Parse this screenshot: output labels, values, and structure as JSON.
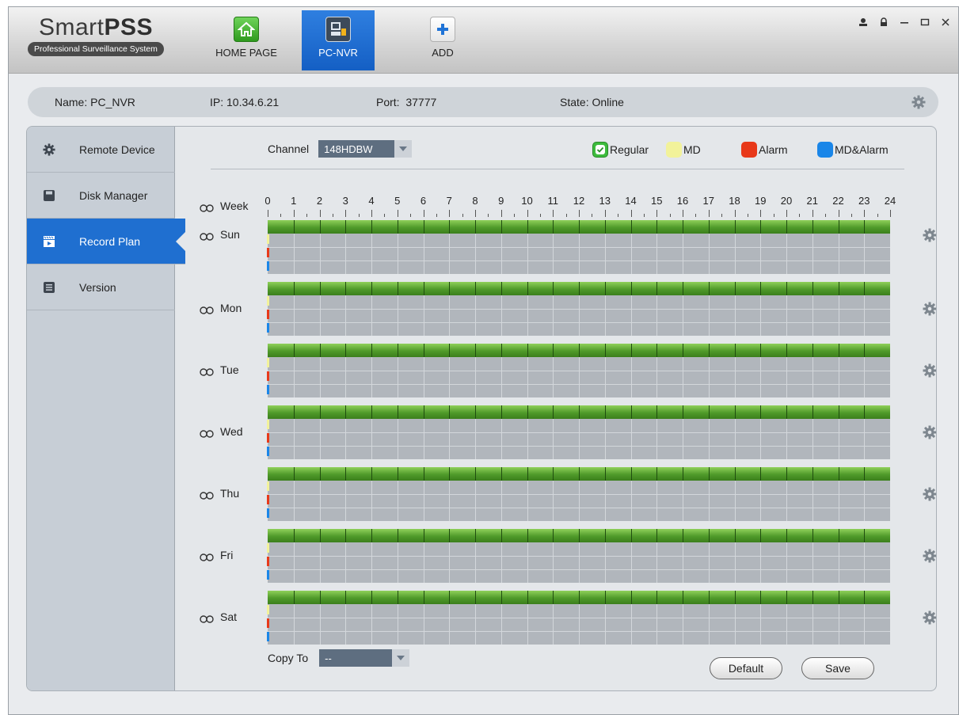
{
  "app": {
    "logo_light": "Smart",
    "logo_bold": "PSS",
    "logo_sub": "Professional Surveillance System"
  },
  "nav": [
    {
      "label": "HOME PAGE",
      "icon": "home-icon"
    },
    {
      "label": "PC-NVR",
      "icon": "nvr-icon"
    },
    {
      "label": "ADD",
      "icon": "plus-icon"
    }
  ],
  "device": {
    "name_label": "Name:",
    "name": "PC_NVR",
    "ip_label": "IP:",
    "ip": "10.34.6.21",
    "port_label": "Port:",
    "port": "37777",
    "state_label": "State:",
    "state": "Online"
  },
  "sidebar": [
    {
      "label": "Remote Device",
      "icon": "gear-icon"
    },
    {
      "label": "Disk Manager",
      "icon": "disk-icon"
    },
    {
      "label": "Record Plan",
      "icon": "record-plan-icon"
    },
    {
      "label": "Version",
      "icon": "version-icon"
    }
  ],
  "channel": {
    "label": "Channel",
    "value": "148HDBW"
  },
  "legend": [
    {
      "label": "Regular",
      "color": "#3dbb3d"
    },
    {
      "label": "MD",
      "color": "#f2f29a"
    },
    {
      "label": "Alarm",
      "color": "#e8391a"
    },
    {
      "label": "MD&Alarm",
      "color": "#1a86e8"
    }
  ],
  "week_label": "Week",
  "hours": [
    "0",
    "1",
    "2",
    "3",
    "4",
    "5",
    "6",
    "7",
    "8",
    "9",
    "10",
    "11",
    "12",
    "13",
    "14",
    "15",
    "16",
    "17",
    "18",
    "19",
    "20",
    "21",
    "22",
    "23",
    "24"
  ],
  "days": [
    "Sun",
    "Mon",
    "Tue",
    "Wed",
    "Thu",
    "Fri",
    "Sat"
  ],
  "copy": {
    "label": "Copy To",
    "value": "--"
  },
  "buttons": {
    "default": "Default",
    "save": "Save"
  }
}
